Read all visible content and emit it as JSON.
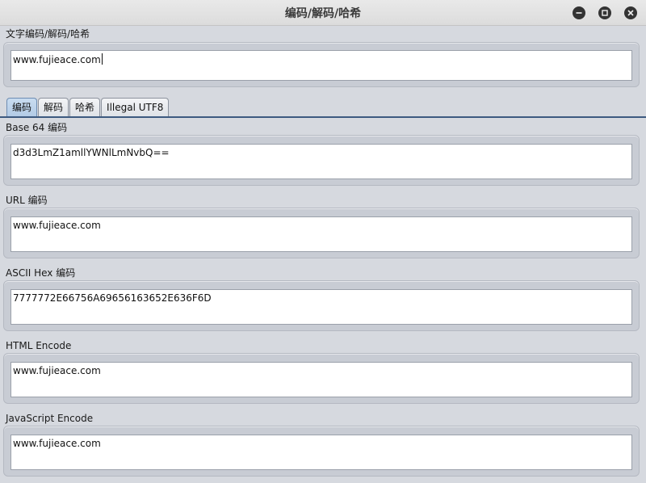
{
  "window": {
    "title": "编码/解码/哈希"
  },
  "input": {
    "label": "文字编码/解码/哈希",
    "value": "www.fujieace.com"
  },
  "tabs": [
    {
      "label": "编码"
    },
    {
      "label": "解码"
    },
    {
      "label": "哈希"
    },
    {
      "label": "Illegal UTF8"
    }
  ],
  "outputs": {
    "base64": {
      "label": "Base 64 编码",
      "value": "d3d3LmZ1amllYWNlLmNvbQ=="
    },
    "url": {
      "label": "URL 编码",
      "value": "www.fujieace.com"
    },
    "ascii_hex": {
      "label": "ASCII Hex 编码",
      "value": "7777772E66756A69656163652E636F6D"
    },
    "html": {
      "label": "HTML Encode",
      "value": "www.fujieace.com"
    },
    "javascript": {
      "label": "JavaScript Encode",
      "value": "www.fujieace.com"
    }
  }
}
